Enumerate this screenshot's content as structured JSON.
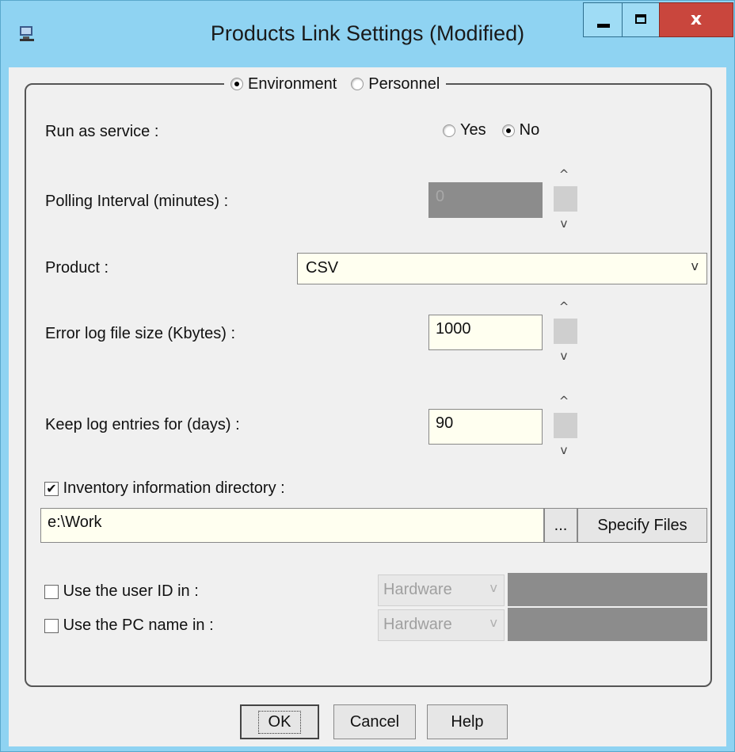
{
  "window": {
    "title": "Products Link Settings (Modified)",
    "close_glyph": "x"
  },
  "mode": {
    "environment_label": "Environment",
    "personnel_label": "Personnel",
    "selected": "Environment"
  },
  "run_as_service": {
    "label": "Run as service :",
    "yes_label": "Yes",
    "no_label": "No",
    "selected": "No"
  },
  "polling": {
    "label": "Polling Interval (minutes) :",
    "value": "0"
  },
  "product": {
    "label": "Product :",
    "value": "CSV"
  },
  "error_log": {
    "label": "Error log file size (Kbytes) :",
    "value": "1000"
  },
  "keep_log": {
    "label": "Keep log entries for (days) :",
    "value": "90"
  },
  "inventory": {
    "label": "Inventory information directory :",
    "checked": true,
    "path": "e:\\Work",
    "browse_label": "...",
    "specify_label": "Specify Files"
  },
  "user_id": {
    "label": "Use the user ID in :",
    "checked": false,
    "select_value": "Hardware"
  },
  "pc_name": {
    "label": "Use the PC name in :",
    "checked": false,
    "select_value": "Hardware"
  },
  "buttons": {
    "ok": "OK",
    "cancel": "Cancel",
    "help": "Help"
  },
  "icons": {
    "spin_up": "^",
    "spin_down": "v",
    "dropdown": "v",
    "check": "✔"
  }
}
